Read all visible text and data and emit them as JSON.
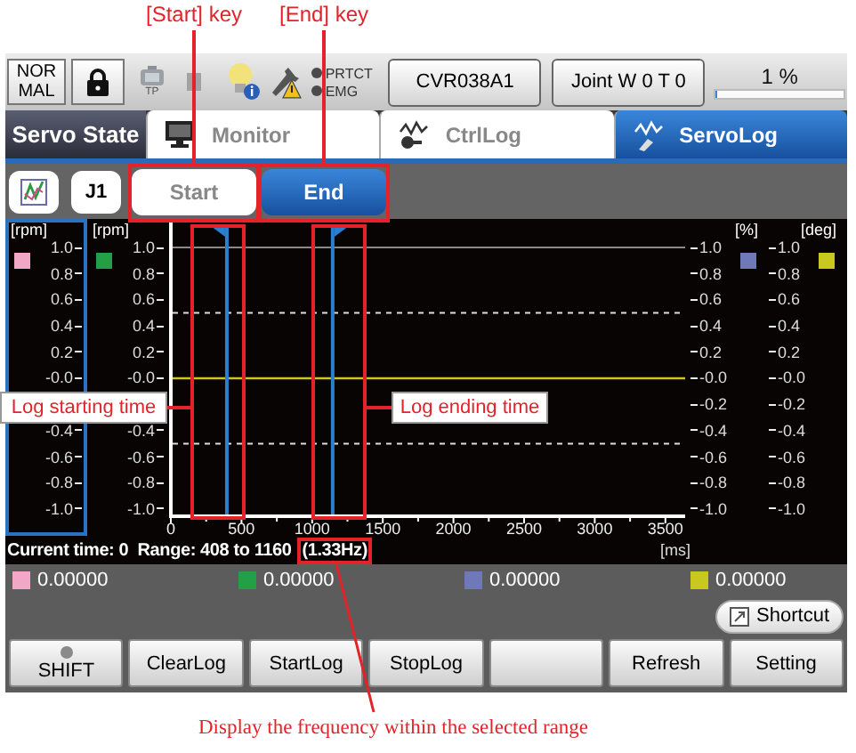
{
  "callouts": {
    "start_key": "[Start] key",
    "end_key": "[End] key",
    "start_time": "Log starting time",
    "end_time": "Log ending time",
    "frequency": "Display the frequency within the selected range"
  },
  "status_bar": {
    "mode": "NORMAL",
    "tp_label": "TP",
    "lamps": [
      {
        "label": "PRTCT",
        "on": false
      },
      {
        "label": "EMG",
        "on": false
      }
    ],
    "program": "CVR038A1",
    "coordinate": "Joint W 0 T 0",
    "speed": {
      "reading": "1 %",
      "level": 0.01
    }
  },
  "header": {
    "title": "Servo State",
    "tabs": [
      {
        "label": "Monitor",
        "selected": false
      },
      {
        "label": "CtrlLog",
        "selected": false
      },
      {
        "label": "ServoLog",
        "selected": true
      }
    ]
  },
  "toolbar": {
    "axis_button": "J1",
    "keys": [
      {
        "label": "Start",
        "selected": false
      },
      {
        "label": "End",
        "selected": true
      }
    ]
  },
  "chart": {
    "axes": [
      {
        "kind": "left",
        "unit": "[rpm]",
        "color": "#f2a7c6",
        "selected": true,
        "ticks": [
          "1.0",
          "0.8",
          "0.6",
          "0.4",
          "0.2",
          "-0.0",
          {
            "kind": "covered"
          },
          "-0.4",
          "-0.6",
          "-0.8",
          "-1.0"
        ]
      },
      {
        "kind": "left",
        "unit": "[rpm]",
        "color": "#23a047",
        "selected": false,
        "ticks": [
          "1.0",
          "0.8",
          "0.6",
          "0.4",
          "0.2",
          "-0.0",
          {
            "kind": "covered"
          },
          "-0.4",
          "-0.6",
          "-0.8",
          "-1.0"
        ]
      },
      {
        "kind": "right",
        "unit": "[%]",
        "color": "#6f78b8",
        "selected": false,
        "ticks": [
          "1.0",
          "0.8",
          "0.6",
          "0.4",
          "0.2",
          "-0.0",
          "-0.2",
          "-0.4",
          "-0.6",
          "-0.8",
          "-1.0"
        ]
      },
      {
        "kind": "right",
        "unit": "[deg]",
        "color": "#c9c81e",
        "selected": false,
        "ticks": [
          "1.0",
          "0.8",
          "0.6",
          "0.4",
          "0.2",
          "-0.0",
          "-0.2",
          "-0.4",
          "-0.6",
          "-0.8",
          "-1.0"
        ]
      }
    ],
    "x_ticks": [
      "0",
      "500",
      "1000",
      "1500",
      "2000",
      "2500",
      "3000",
      "3500"
    ],
    "cursors": [
      {
        "kind": "start",
        "level": 0.112
      },
      {
        "kind": "end",
        "level": 0.317
      }
    ]
  },
  "range_info": {
    "text": "Current time: 0  Range: 408 to 1160",
    "frequency": "(1.33Hz)",
    "x_unit": "[ms]"
  },
  "legend": [
    {
      "color": "#f2a7c6",
      "value": "0.00000"
    },
    {
      "color": "#23a047",
      "value": "0.00000"
    },
    {
      "color": "#6f78b8",
      "value": "0.00000"
    },
    {
      "color": "#c9c81e",
      "value": "0.00000"
    }
  ],
  "shortcut": "Shortcut",
  "buttons": [
    {
      "kind": "shift",
      "label": "SHIFT"
    },
    {
      "kind": "plain",
      "label": "ClearLog"
    },
    {
      "kind": "plain",
      "label": "StartLog"
    },
    {
      "kind": "plain",
      "label": "StopLog"
    },
    {
      "kind": "blank"
    },
    {
      "kind": "plain",
      "label": "Refresh"
    },
    {
      "kind": "plain",
      "label": "Setting"
    }
  ]
}
